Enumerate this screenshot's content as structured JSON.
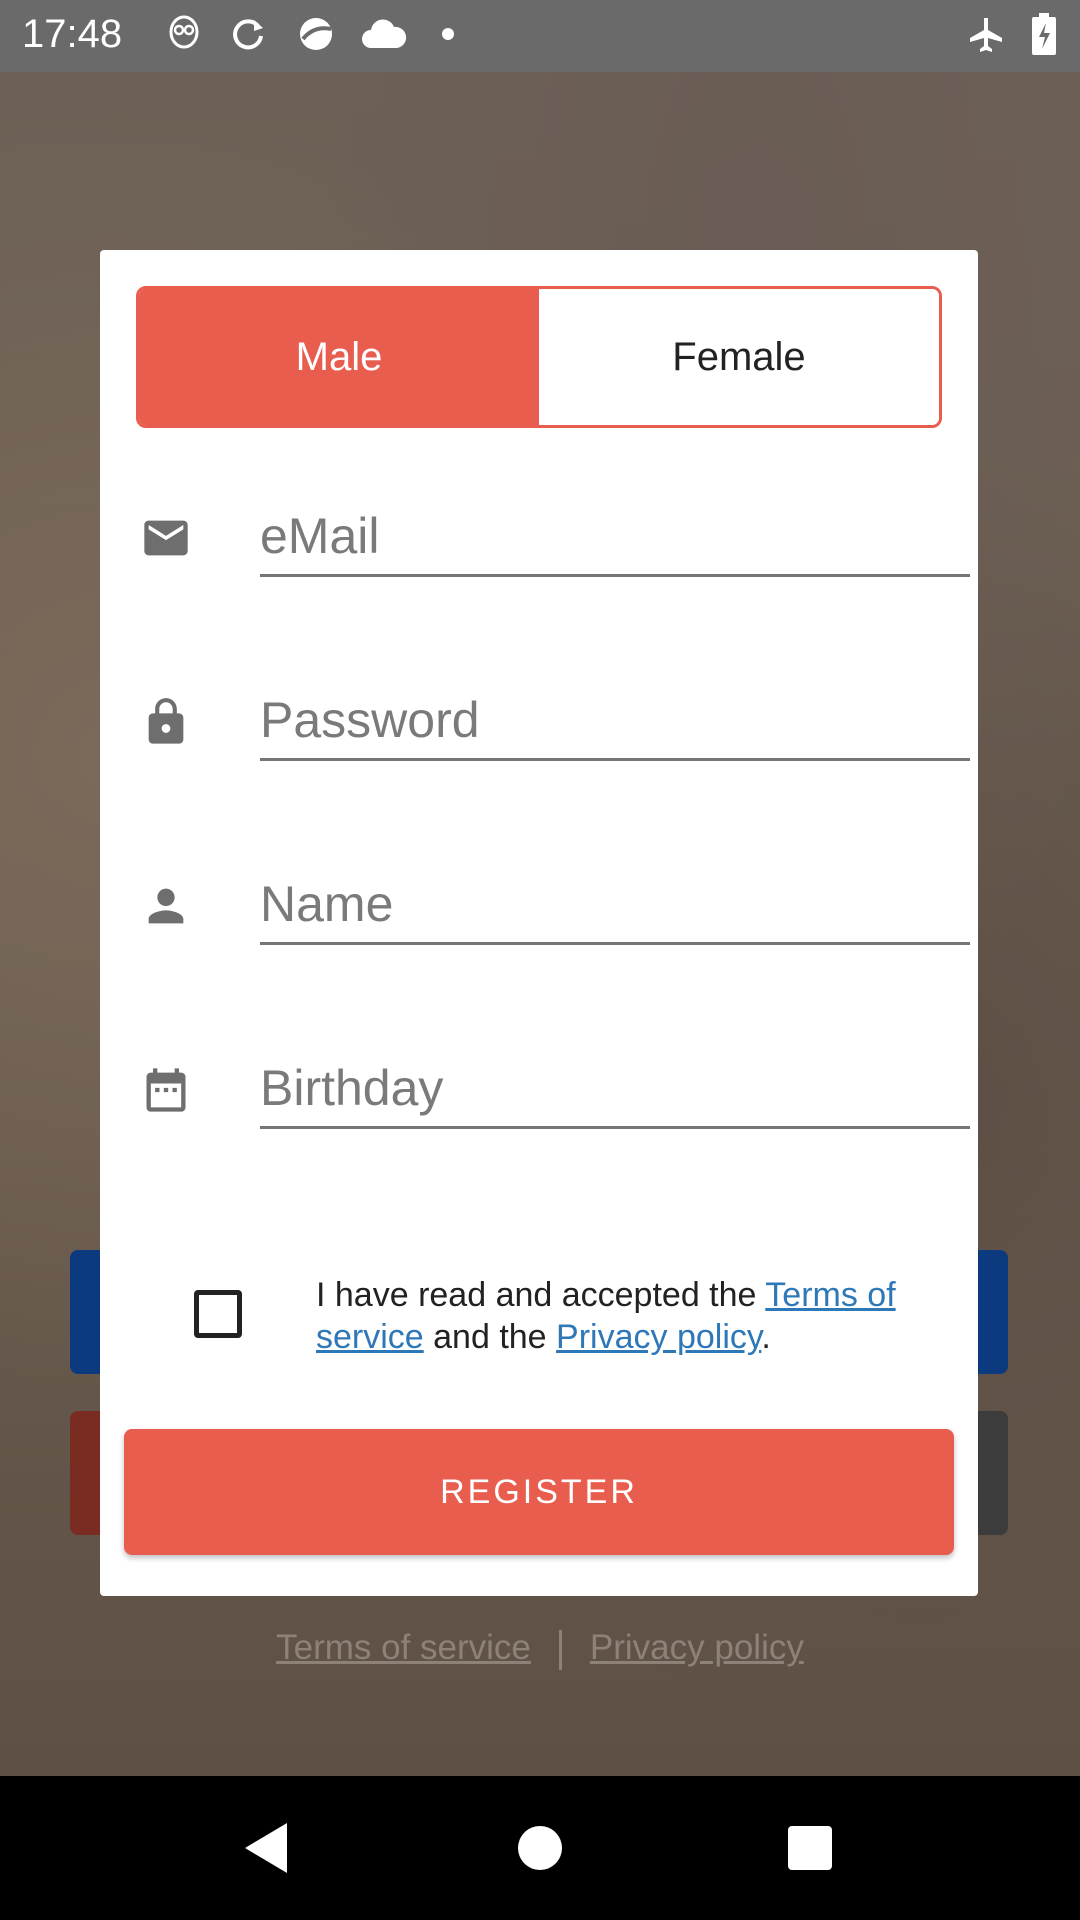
{
  "status_bar": {
    "time": "17:48",
    "left_icons": [
      "alien-icon",
      "sync-icon",
      "browser-icon",
      "cloud-icon",
      "dot-icon"
    ],
    "right_icons": [
      "airplane-mode-icon",
      "battery-charging-icon"
    ]
  },
  "gender_toggle": {
    "options": [
      "Male",
      "Female"
    ],
    "selected": "Male",
    "active_color": "#e95d4e"
  },
  "form": {
    "email": {
      "placeholder": "eMail",
      "icon": "mail-icon"
    },
    "password": {
      "placeholder": "Password",
      "icon": "lock-icon"
    },
    "name": {
      "placeholder": "Name",
      "icon": "person-icon"
    },
    "birthday": {
      "placeholder": "Birthday",
      "icon": "calendar-icon"
    }
  },
  "terms": {
    "checked": false,
    "text_before": "I have read and accepted the ",
    "terms_link": "Terms of service",
    "text_middle": " and the ",
    "privacy_link": "Privacy policy",
    "text_after": "."
  },
  "register_button": {
    "label": "REGISTER"
  },
  "footer": {
    "terms_link": "Terms of service",
    "privacy_link": "Privacy policy"
  },
  "nav_bar": {
    "buttons": [
      "back-icon",
      "home-icon",
      "recents-icon"
    ]
  }
}
